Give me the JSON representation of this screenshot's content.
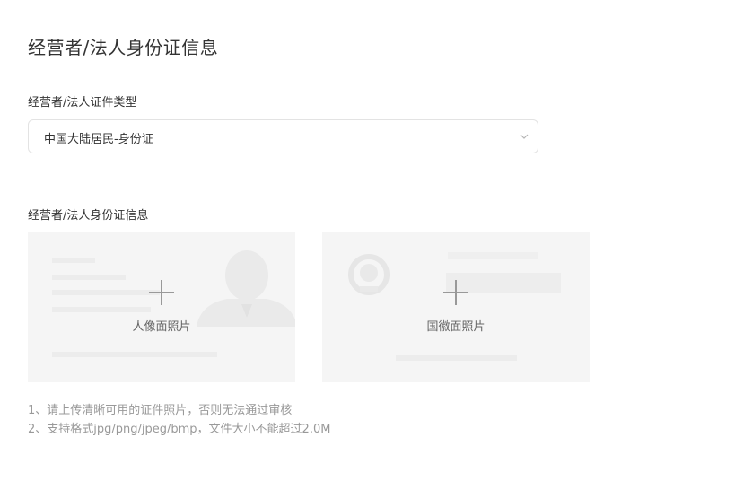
{
  "section": {
    "title": "经营者/法人身份证信息"
  },
  "id_type": {
    "label": "经营者/法人证件类型",
    "value": "中国大陆居民-身份证"
  },
  "id_info": {
    "label": "经营者/法人身份证信息",
    "front_label": "人像面照片",
    "back_label": "国徽面照片"
  },
  "tips": [
    "1、请上传清晰可用的证件照片，否则无法通过审核",
    "2、支持格式jpg/png/jpeg/bmp，文件大小不能超过2.0M"
  ],
  "icons": {
    "select_caret": "chevron-down-icon",
    "upload": "plus-icon"
  },
  "colors": {
    "card_bg": "#f5f5f5",
    "border": "#e3e3e3",
    "tip_text": "#999999"
  }
}
